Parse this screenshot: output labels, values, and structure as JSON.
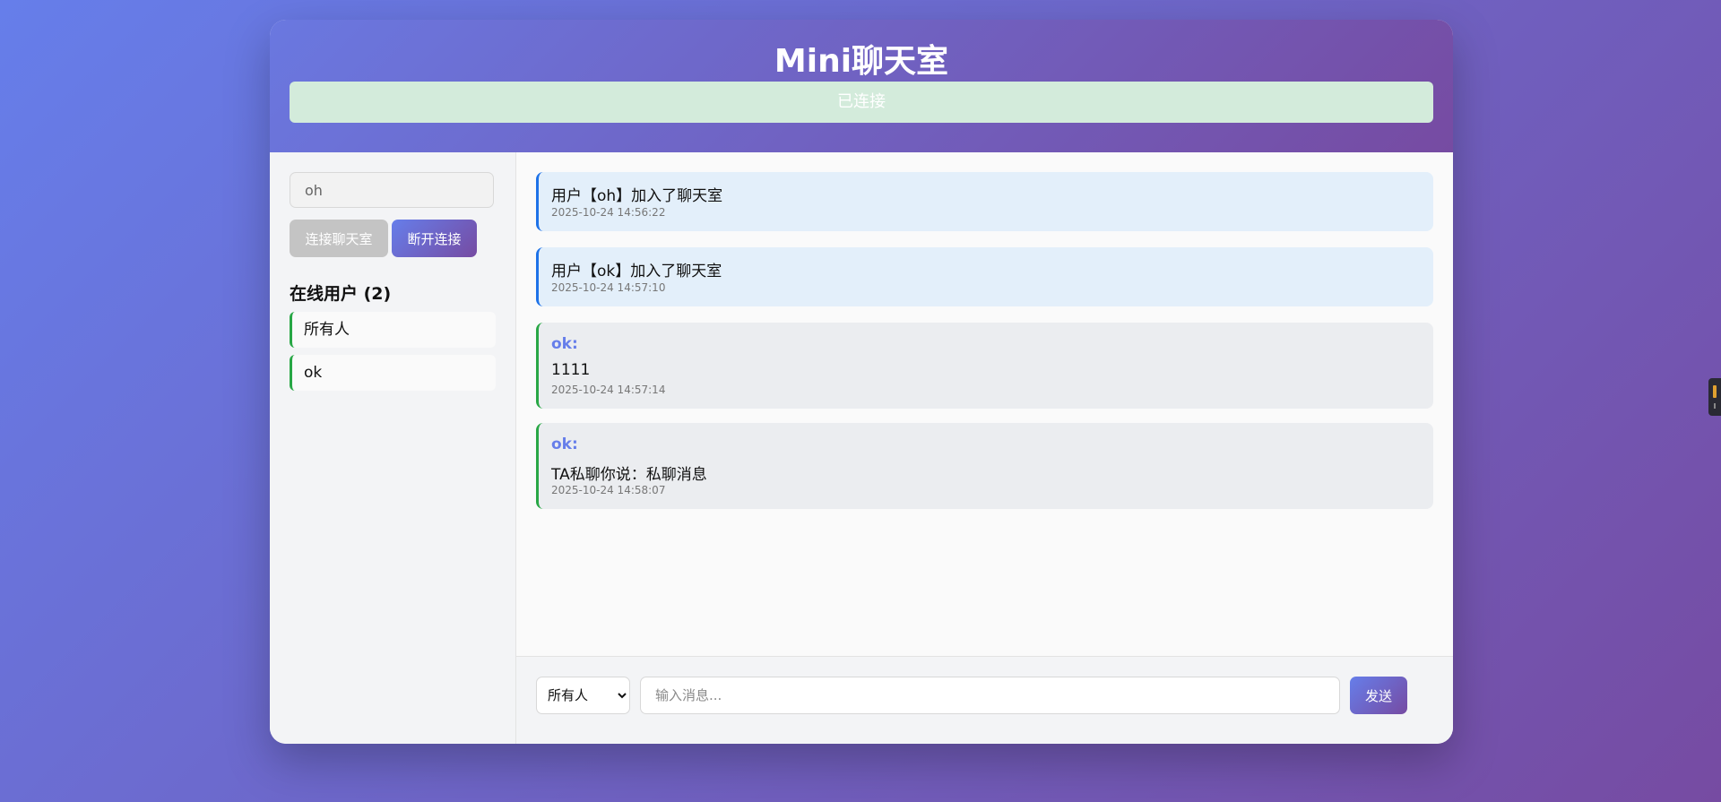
{
  "header": {
    "title": "Mini聊天室",
    "status": "已连接"
  },
  "sidebar": {
    "username_value": "oh",
    "connect_label": "连接聊天室",
    "disconnect_label": "断开连接",
    "online_title": "在线用户 (2)",
    "users": [
      "所有人",
      "ok"
    ]
  },
  "messages": [
    {
      "type": "system",
      "text": "用户【oh】加入了聊天室",
      "time": "2025-10-24 14:56:22"
    },
    {
      "type": "system",
      "text": "用户【ok】加入了聊天室",
      "time": "2025-10-24 14:57:10"
    },
    {
      "type": "user",
      "sender": "ok:",
      "text": "1111",
      "time": "2025-10-24 14:57:14"
    },
    {
      "type": "user",
      "sender": "ok:",
      "text": "TA私聊你说：私聊消息",
      "time": "2025-10-24 14:58:07"
    }
  ],
  "footer": {
    "target_selected": "所有人",
    "input_placeholder": "输入消息...",
    "send_label": "发送"
  },
  "colors": {
    "gradient_start": "#667eea",
    "gradient_end": "#764ba2",
    "system_border": "#1d72e8",
    "user_border": "#28a745",
    "status_bg": "#d3ebdb"
  }
}
